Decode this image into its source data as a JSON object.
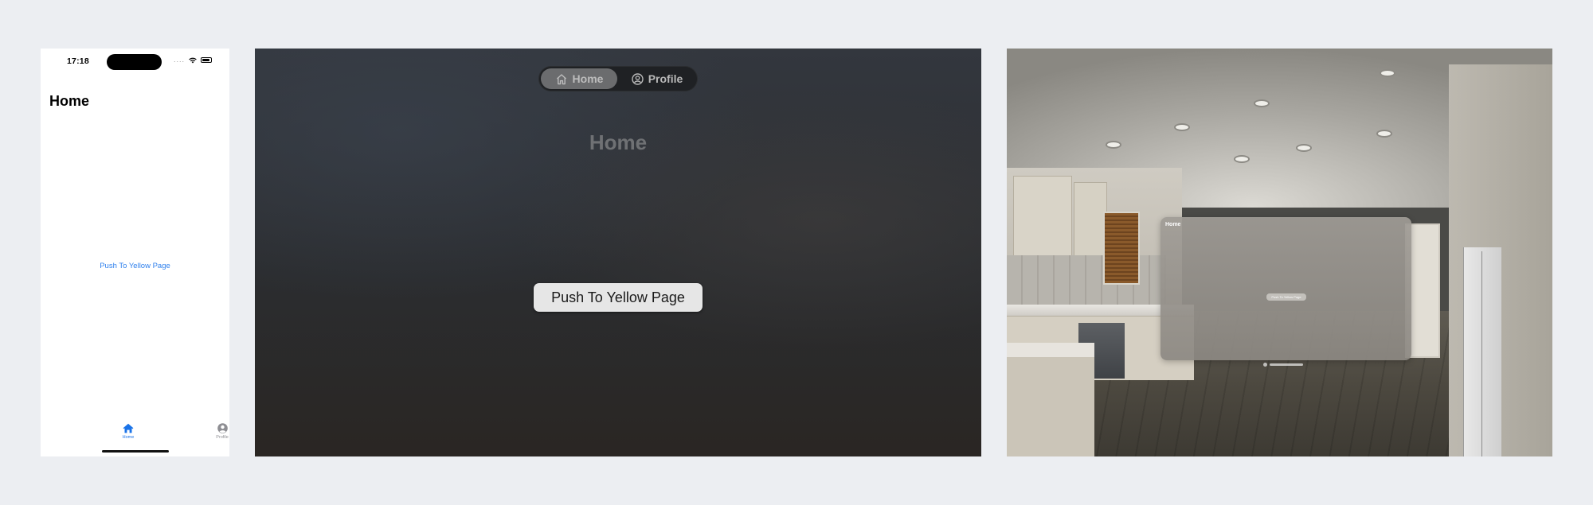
{
  "iphone": {
    "status_time": "17:18",
    "signal_text": "....",
    "title": "Home",
    "link_label": "Push To Yellow Page",
    "link_color": "#2f80ed",
    "tabs": [
      {
        "label": "Home",
        "icon": "house-fill-icon",
        "selected": true
      },
      {
        "label": "Profile",
        "icon": "person-circle-fill-icon",
        "selected": false
      }
    ]
  },
  "vision_window": {
    "ornament_tabs": [
      {
        "label": "Home",
        "icon": "house-icon",
        "selected": true
      },
      {
        "label": "Profile",
        "icon": "person-circle-icon",
        "selected": false
      }
    ],
    "title": "Home",
    "button_label": "Push To Yellow Page"
  },
  "passthrough": {
    "window_title": "Home",
    "button_label": "Push To Yellow Page"
  }
}
